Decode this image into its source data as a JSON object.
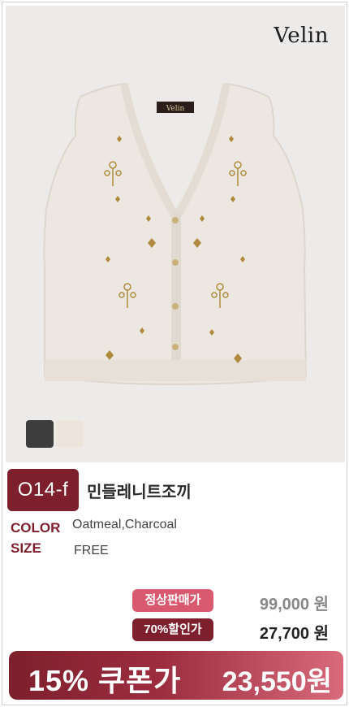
{
  "brand": {
    "logo_text": "Velin",
    "label_text": "Velin"
  },
  "product": {
    "code": "O14-f",
    "name": "민들레니트조끼"
  },
  "swatches": [
    {
      "name": "Charcoal",
      "color": "#3d3d3d"
    },
    {
      "name": "Oatmeal",
      "color": "#ede4dc"
    }
  ],
  "specs": {
    "color_label": "COLOR",
    "color_value": "Oatmeal,Charcoal",
    "size_label": "SIZE",
    "size_value": "FREE"
  },
  "pricing": {
    "regular_label": "정상판매가",
    "regular_price": "99,000 원",
    "discount_label": "70%할인가",
    "discount_price": "27,700 원"
  },
  "coupon": {
    "label": "15% 쿠폰가",
    "price": "23,550원"
  },
  "colors": {
    "accent": "#7d1f2c",
    "pink": "#d95a6e",
    "embroidery": "#b08a3c"
  }
}
